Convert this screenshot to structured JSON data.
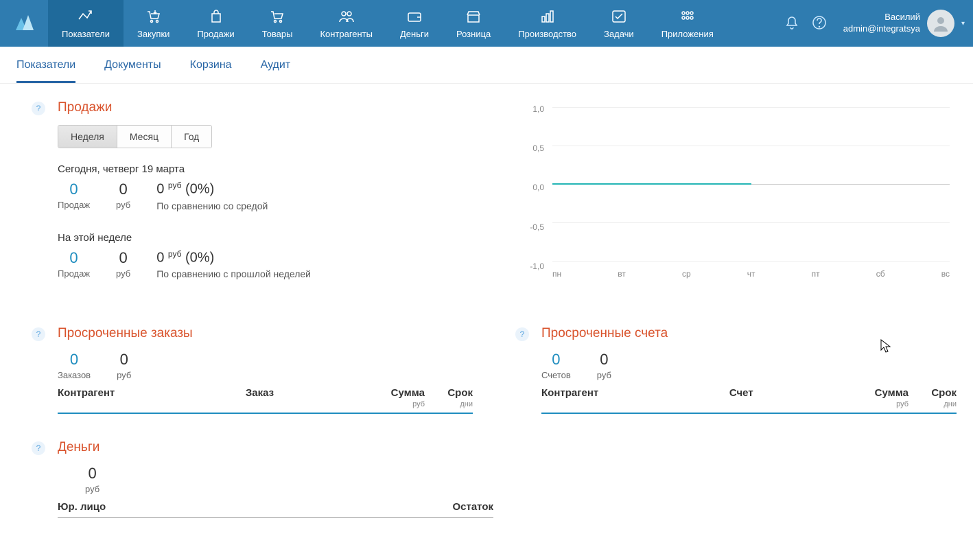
{
  "nav": {
    "items": [
      {
        "label": "Показатели",
        "active": true,
        "icon": "chart"
      },
      {
        "label": "Закупки",
        "icon": "cart-down"
      },
      {
        "label": "Продажи",
        "icon": "bag"
      },
      {
        "label": "Товары",
        "icon": "cart"
      },
      {
        "label": "Контрагенты",
        "icon": "people"
      },
      {
        "label": "Деньги",
        "icon": "wallet"
      },
      {
        "label": "Розница",
        "icon": "store"
      },
      {
        "label": "Производство",
        "icon": "bars"
      },
      {
        "label": "Задачи",
        "icon": "check"
      },
      {
        "label": "Приложения",
        "icon": "apps"
      }
    ]
  },
  "user": {
    "name": "Василий",
    "email": "admin@integratsya"
  },
  "subnav": {
    "items": [
      {
        "label": "Показатели",
        "active": true
      },
      {
        "label": "Документы"
      },
      {
        "label": "Корзина"
      },
      {
        "label": "Аудит"
      }
    ]
  },
  "sales": {
    "title": "Продажи",
    "periods": [
      {
        "label": "Неделя",
        "active": true
      },
      {
        "label": "Месяц"
      },
      {
        "label": "Год"
      }
    ],
    "today": {
      "label": "Сегодня, четверг 19 марта",
      "count": "0",
      "count_label": "Продаж",
      "sum": "0",
      "sum_label": "руб",
      "diff_amount": "0",
      "diff_currency": "руб",
      "diff_pct": "(0%)",
      "compare": "По сравнению со средой"
    },
    "week": {
      "label": "На этой неделе",
      "count": "0",
      "count_label": "Продаж",
      "sum": "0",
      "sum_label": "руб",
      "diff_amount": "0",
      "diff_currency": "руб",
      "diff_pct": "(0%)",
      "compare": "По сравнению с прошлой неделей"
    }
  },
  "chart_data": {
    "type": "line",
    "x": [
      "пн",
      "вт",
      "ср",
      "чт",
      "пт",
      "сб",
      "вс"
    ],
    "series": [
      {
        "name": "Продажи",
        "values": [
          0,
          0,
          0,
          0,
          null,
          null,
          null
        ]
      }
    ],
    "ylim": [
      -1.0,
      1.0
    ],
    "yticks": [
      "1,0",
      "0,5",
      "0,0",
      "-0,5",
      "-1,0"
    ]
  },
  "overdue_orders": {
    "title": "Просроченные заказы",
    "count": "0",
    "count_label": "Заказов",
    "sum": "0",
    "sum_label": "руб",
    "columns": {
      "c1": "Контрагент",
      "c2": "Заказ",
      "c3": "Сумма",
      "c3u": "руб",
      "c4": "Срок",
      "c4u": "дни"
    }
  },
  "overdue_invoices": {
    "title": "Просроченные счета",
    "count": "0",
    "count_label": "Счетов",
    "sum": "0",
    "sum_label": "руб",
    "columns": {
      "c1": "Контрагент",
      "c2": "Счет",
      "c3": "Сумма",
      "c3u": "руб",
      "c4": "Срок",
      "c4u": "дни"
    }
  },
  "money": {
    "title": "Деньги",
    "sum": "0",
    "sum_label": "руб",
    "columns": {
      "c1": "Юр. лицо",
      "c2": "Остаток"
    }
  },
  "help": "?"
}
